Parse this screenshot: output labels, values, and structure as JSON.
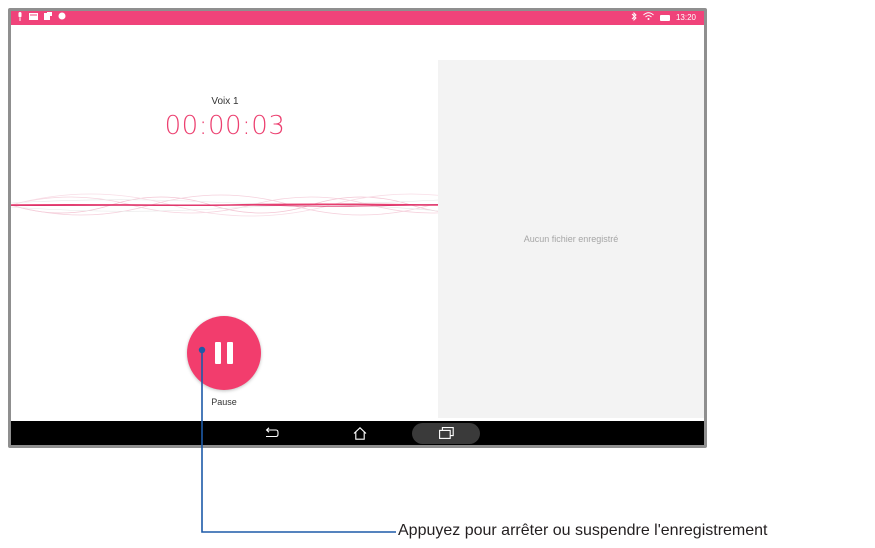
{
  "status_bar": {
    "left_icons": [
      "mic-icon",
      "message-icon",
      "notification-icon",
      "chat-icon"
    ],
    "right_icons": [
      "bluetooth-icon",
      "wifi-icon",
      "battery-icon"
    ],
    "time": "13:20"
  },
  "recorder": {
    "name": "Voix 1",
    "elapsed": "00:00:03",
    "pause_label": "Pause"
  },
  "files_panel": {
    "empty_text": "Aucun fichier enregistré"
  },
  "nav_bar": {
    "buttons": [
      "back-icon",
      "home-icon",
      "recents-icon"
    ]
  },
  "callout": {
    "text": "Appuyez pour arrêter ou suspendre l'enregistrement"
  },
  "colors": {
    "accent": "#f23d6d",
    "status_bar": "#f0437a",
    "navbar": "#000000"
  }
}
